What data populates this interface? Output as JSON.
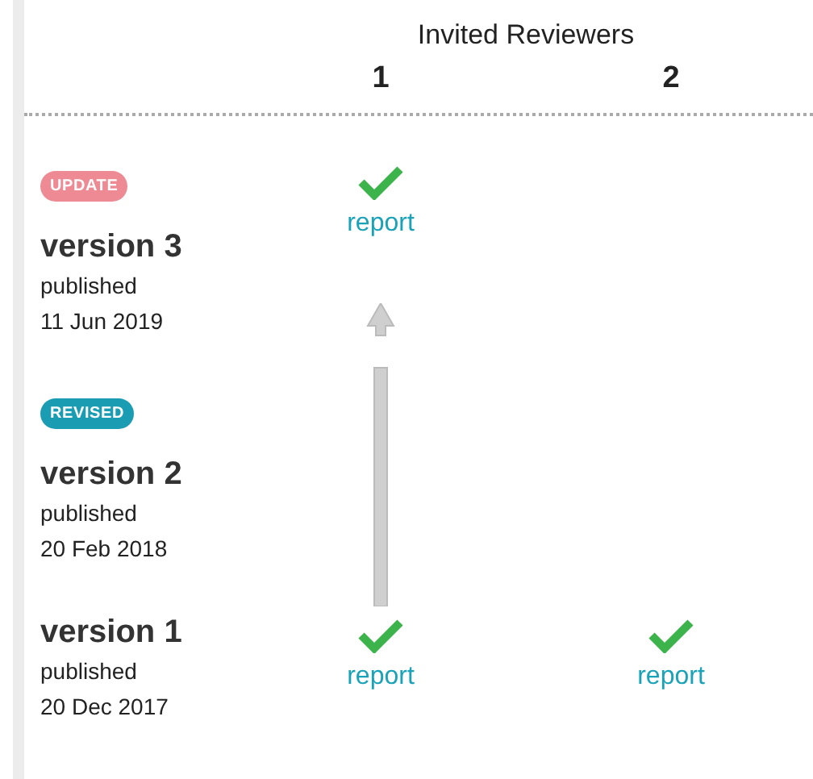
{
  "header": {
    "title": "Invited Reviewers",
    "reviewers": [
      "1",
      "2"
    ]
  },
  "versions": [
    {
      "badge": {
        "label": "UPDATE",
        "color": "#ee8a93"
      },
      "title": "version 3",
      "status": "published",
      "date": "11 Jun 2019",
      "cells": [
        {
          "kind": "report",
          "link": "report"
        },
        {
          "kind": "none"
        }
      ]
    },
    {
      "badge": {
        "label": "REVISED",
        "color": "#1a9db3"
      },
      "title": "version 2",
      "status": "published",
      "date": "20 Feb 2018",
      "cells": [
        {
          "kind": "arrow"
        },
        {
          "kind": "none"
        }
      ]
    },
    {
      "title": "version 1",
      "status": "published",
      "date": "20 Dec 2017",
      "cells": [
        {
          "kind": "report",
          "link": "report"
        },
        {
          "kind": "report",
          "link": "report"
        }
      ]
    }
  ]
}
